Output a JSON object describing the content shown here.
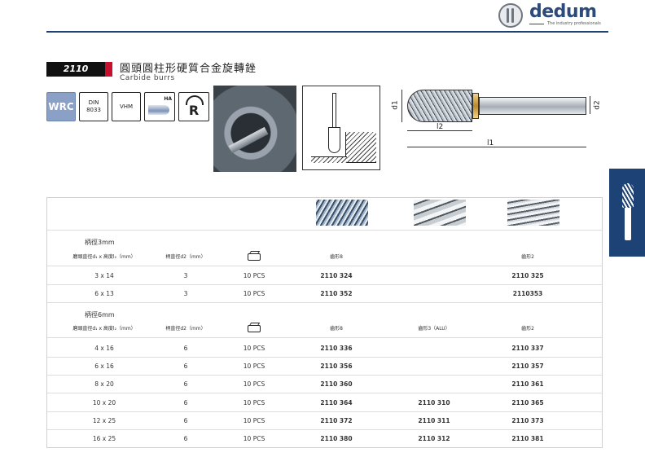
{
  "header": {
    "brand": "dedum",
    "tagline": "The industry professionals"
  },
  "product": {
    "code": "2110",
    "title_zh": "圓頭圓柱形硬質合金旋轉銼",
    "title_en": "Carbide burrs"
  },
  "spec_icons": {
    "material": "WRC",
    "din_line1": "DIN",
    "din_line2": "8033",
    "hardmetal": "VHM",
    "shank_label": "HA",
    "shape": "R"
  },
  "dimension_labels": {
    "d1": "d1",
    "d2": "d2",
    "l1": "l1",
    "l2": "l2"
  },
  "colors": {
    "brand_blue": "#1d4275",
    "badge_black": "#111111",
    "badge_red": "#c8102e",
    "wrc_blue": "#8aa0c7"
  },
  "table": {
    "groups": [
      {
        "title": "柄徑3mm",
        "headers": {
          "size": "磨頭直徑d₁ x 高度l₂（mm）",
          "shank": "柄直徑d2（mm）",
          "pack_icon": "package-icon",
          "tooth8": "齒形8",
          "tooth3": "",
          "tooth2": "齒形2"
        },
        "rows": [
          {
            "size": "3 x 14",
            "shank": "3",
            "pack": "10  PCS",
            "tooth8": "2110 324",
            "tooth3": "",
            "tooth2": "2110 325"
          },
          {
            "size": "6 x 13",
            "shank": "3",
            "pack": "10  PCS",
            "tooth8": "2110 352",
            "tooth3": "",
            "tooth2": "2110353"
          }
        ]
      },
      {
        "title": "柄徑6mm",
        "headers": {
          "size": "磨頭直徑d₁ x 高度l₂（mm）",
          "shank": "柄直徑d2（mm）",
          "pack_icon": "package-icon",
          "tooth8": "齒形8",
          "tooth3": "齒形3（ALU）",
          "tooth2": "齒形2"
        },
        "rows": [
          {
            "size": "4 x 16",
            "shank": "6",
            "pack": "10  PCS",
            "tooth8": "2110 336",
            "tooth3": "",
            "tooth2": "2110 337"
          },
          {
            "size": "6 x 16",
            "shank": "6",
            "pack": "10  PCS",
            "tooth8": "2110 356",
            "tooth3": "",
            "tooth2": "2110 357"
          },
          {
            "size": "8 x 20",
            "shank": "6",
            "pack": "10  PCS",
            "tooth8": "2110 360",
            "tooth3": "",
            "tooth2": "2110 361"
          },
          {
            "size": "10 x 20",
            "shank": "6",
            "pack": "10  PCS",
            "tooth8": "2110 364",
            "tooth3": "2110 310",
            "tooth2": "2110 365"
          },
          {
            "size": "12 x 25",
            "shank": "6",
            "pack": "10  PCS",
            "tooth8": "2110 372",
            "tooth3": "2110 311",
            "tooth2": "2110 373"
          },
          {
            "size": "16 x 25",
            "shank": "6",
            "pack": "10  PCS",
            "tooth8": "2110 380",
            "tooth3": "2110 312",
            "tooth2": "2110 381"
          }
        ]
      }
    ]
  }
}
